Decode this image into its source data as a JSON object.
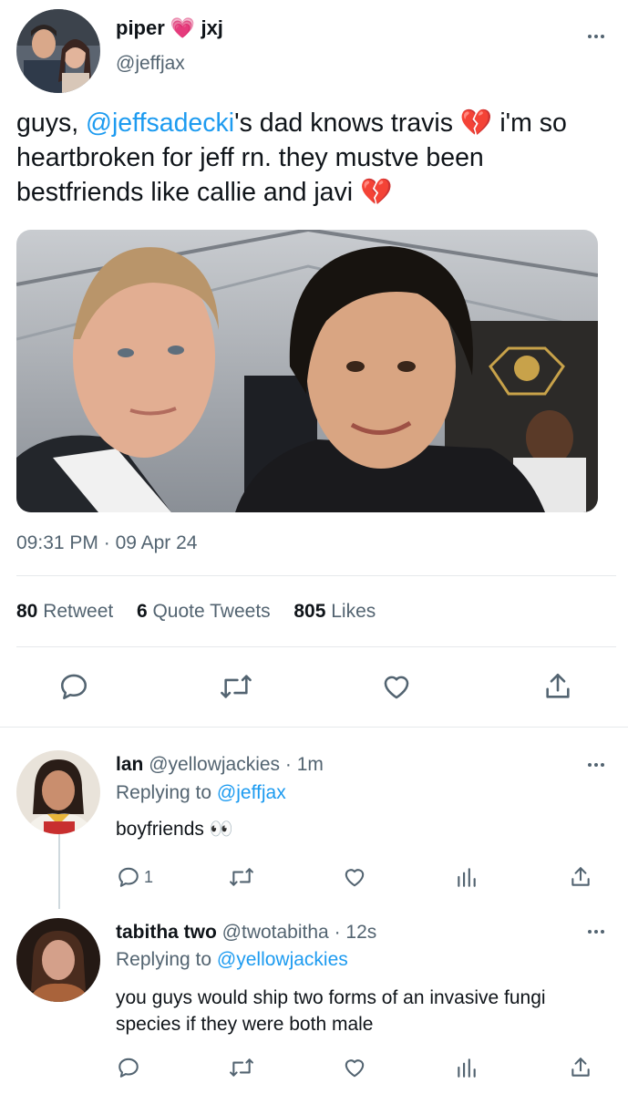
{
  "tweet": {
    "display_name": "piper",
    "name_emoji": "💗",
    "name_suffix": "jxj",
    "handle": "@jeffjax",
    "text_part1": "guys, ",
    "mention": "@jeffsadecki",
    "text_part2": "'s dad knows travis ",
    "emoji1": "💔",
    "text_part3": " i'm so heartbroken for jeff rn. they mustve been bestfriends like callie and javi ",
    "emoji2": "💔",
    "time": "09:31 PM",
    "dot": "·",
    "date": "09 Apr 24",
    "retweet_count": "80",
    "retweet_label": "Retweet",
    "quote_count": "6",
    "quote_label": "Quote Tweets",
    "like_count": "805",
    "like_label": "Likes",
    "icons": [
      "reply-icon",
      "retweet-icon",
      "like-icon",
      "share-icon"
    ]
  },
  "replies": [
    {
      "name": "lan",
      "handle": "@yellowjackies",
      "dot": "·",
      "time": "1m",
      "replying_label": "Replying to",
      "replying_to": "@jeffjax",
      "text": "boyfriends",
      "text_emoji": "👀",
      "reply_count": "1"
    },
    {
      "name": "tabitha two",
      "handle": "@twotabitha",
      "dot": "·",
      "time": "12s",
      "replying_label": "Replying to",
      "replying_to": "@yellowjackies",
      "text": "you guys would ship two forms of an invasive fungi species if they were both male",
      "reply_count": ""
    }
  ],
  "colors": {
    "link": "#1d9bf0",
    "muted": "#536471",
    "heart_emoji": "#f25c84",
    "broken_heart": "#e0245e"
  }
}
